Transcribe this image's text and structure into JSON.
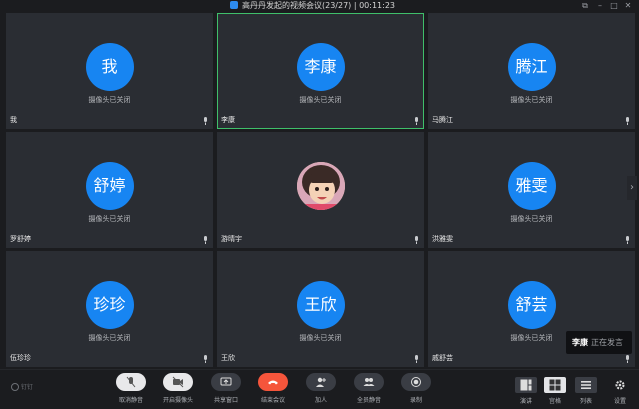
{
  "window": {
    "title": "高丹丹发起的视频会议(23/27) | 00:11:23"
  },
  "participants": [
    {
      "avatar_text": "我",
      "name": "我",
      "status": "摄像头已关闭",
      "active": false,
      "photo": false
    },
    {
      "avatar_text": "李康",
      "name": "李康",
      "status": "摄像头已关闭",
      "active": true,
      "photo": false
    },
    {
      "avatar_text": "腾江",
      "name": "马腾江",
      "status": "摄像头已关闭",
      "active": false,
      "photo": false
    },
    {
      "avatar_text": "舒婷",
      "name": "罗舒婷",
      "status": "摄像头已关闭",
      "active": false,
      "photo": false
    },
    {
      "avatar_text": "",
      "name": "游晴宇",
      "status": "",
      "active": false,
      "photo": true
    },
    {
      "avatar_text": "雅雯",
      "name": "洪雅雯",
      "status": "摄像头已关闭",
      "active": false,
      "photo": false
    },
    {
      "avatar_text": "珍珍",
      "name": "伍珍珍",
      "status": "摄像头已关闭",
      "active": false,
      "photo": false
    },
    {
      "avatar_text": "王欣",
      "name": "王欣",
      "status": "摄像头已关闭",
      "active": false,
      "photo": false
    },
    {
      "avatar_text": "舒芸",
      "name": "戚舒芸",
      "status": "摄像头已关闭",
      "active": false,
      "photo": false
    }
  ],
  "speaking": {
    "name": "李康",
    "text": "正在发言"
  },
  "brand": "钉钉",
  "toolbar": {
    "unmute": "取消静音",
    "camera": "开启摄像头",
    "share": "共享窗口",
    "end": "结束会议",
    "join": "加人",
    "mute_all": "全员静音",
    "record": "录制"
  },
  "views": {
    "speaker": "演讲",
    "grid": "宫格",
    "list": "列表",
    "settings": "设置"
  },
  "colors": {
    "accent": "#1785f2",
    "end_call": "#f5553b",
    "active_border": "#3fbf6a"
  }
}
